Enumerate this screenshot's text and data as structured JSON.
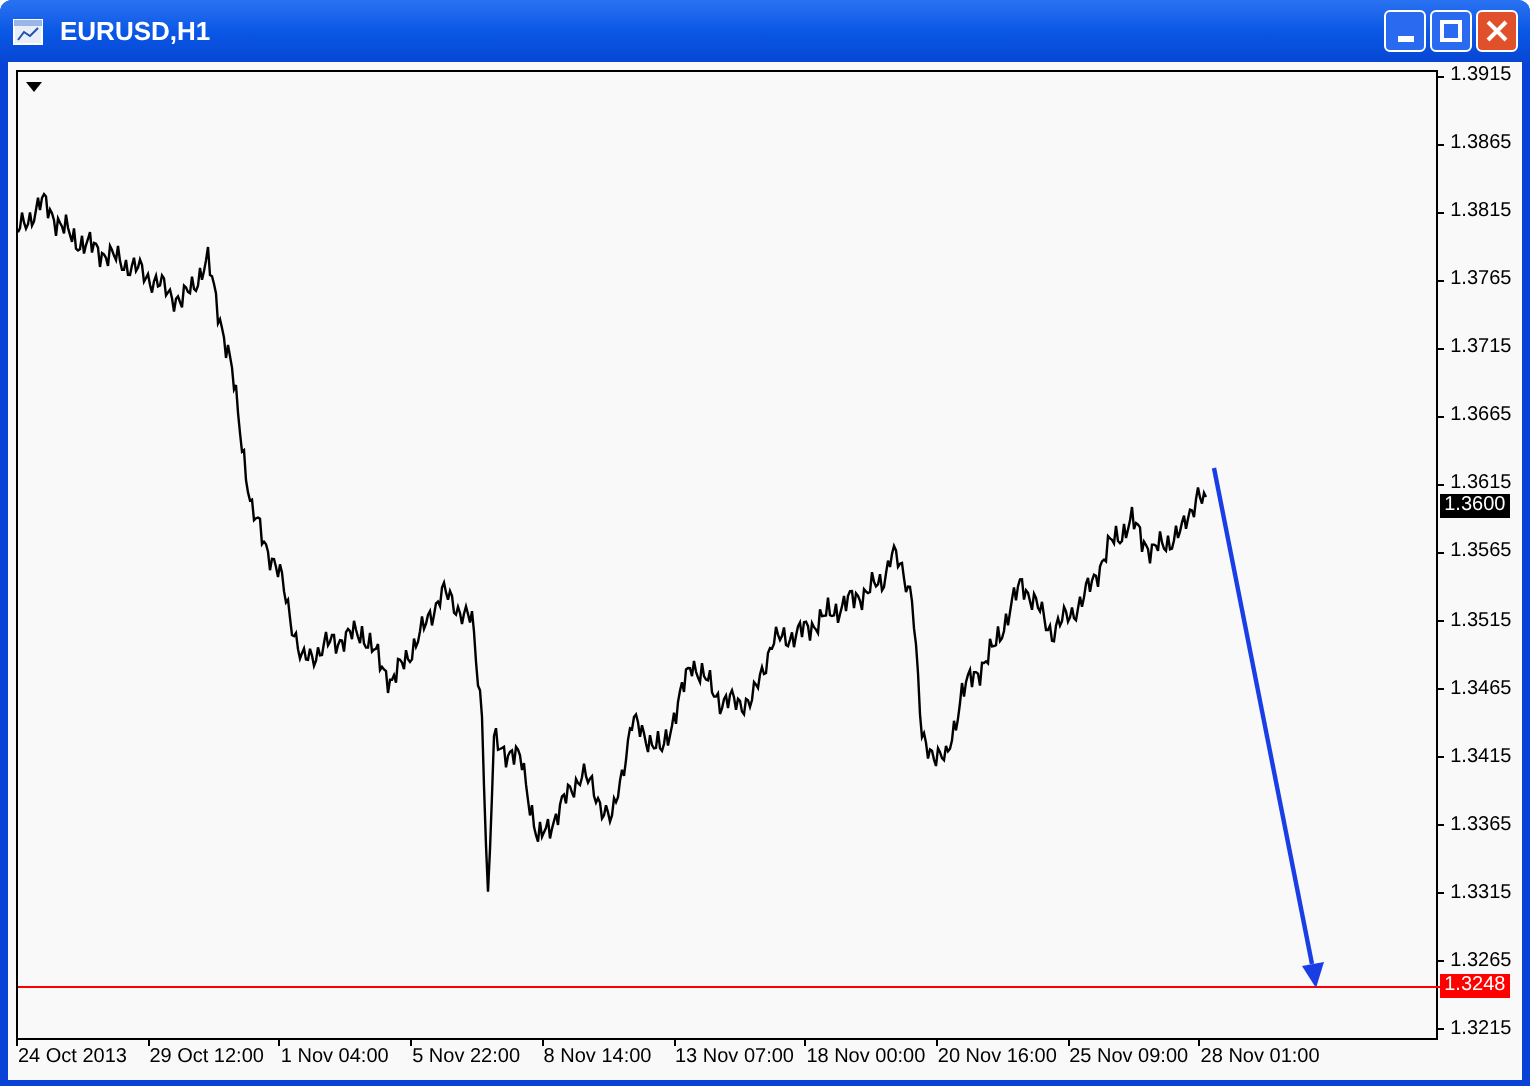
{
  "window": {
    "title": "EURUSD,H1"
  },
  "price_axis": [
    "1.3915",
    "1.3865",
    "1.3815",
    "1.3765",
    "1.3715",
    "1.3665",
    "1.3615",
    "1.3565",
    "1.3515",
    "1.3465",
    "1.3415",
    "1.3365",
    "1.3315",
    "1.3265",
    "1.3215"
  ],
  "price_markers": [
    {
      "kind": "bid",
      "label": "1.3600"
    },
    {
      "kind": "hline",
      "label": "1.3248"
    }
  ],
  "time_axis": [
    "24 Oct 2013",
    "29 Oct 12:00",
    "1 Nov 04:00",
    "5 Nov 22:00",
    "8 Nov 14:00",
    "13 Nov 07:00",
    "18 Nov 00:00",
    "20 Nov 16:00",
    "25 Nov 09:00",
    "28 Nov 01:00"
  ]
}
